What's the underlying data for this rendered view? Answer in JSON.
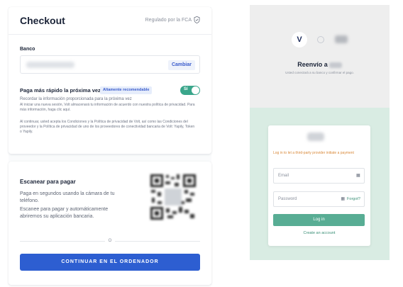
{
  "checkout": {
    "title": "Checkout",
    "regulated_text": "Regulado por la FCA",
    "bank": {
      "label": "Banco",
      "change_button": "Cambiar"
    },
    "fast_pay": {
      "title": "Paga más rápido la próxima vez",
      "badge": "Altamente recomendable",
      "toggle_label": "Sí",
      "toggle_on": true,
      "remember_text": "Recordar la información proporcionada para la próxima vez",
      "detail_text": "Al iniciar una nueva sesión, Volt almacenará tu información de acuerdo con nuestra política de privacidad. Para más información, haga clic aquí.",
      "legal_text": "Al continuar, usted acepta los Condiciones y la Política de privacidad de Volt, así como las Condiciones del proveedor y la Política de privacidad de uno de los proveedores de conectividad bancaria de Volt: Yapily, Token o Yapily."
    },
    "scan": {
      "title": "Escanear para pagar",
      "line1": "Paga en segundos usando la cámara de tu teléfono.",
      "line2": "Escanee para pagar y automáticamente abriremos su aplicación bancaria."
    },
    "divider_text": "O",
    "continue_button": "CONTINUAR EN EL ORDENADOR",
    "accent_color": "#2d5ed1",
    "toggle_color": "#3aa68b"
  },
  "bank_login": {
    "heading": "Reenvío a",
    "subheading": "Usted conectará a su banco y confirmar el pago.",
    "warning": "Log in to let a third-party provider initiate a payment",
    "email_label": "Email",
    "password_label": "Password",
    "forgot_label": "Forgot?",
    "login_button": "Log in",
    "create_account": "Create an account",
    "logo_letter": "V",
    "brand_color": "#58ad94"
  }
}
